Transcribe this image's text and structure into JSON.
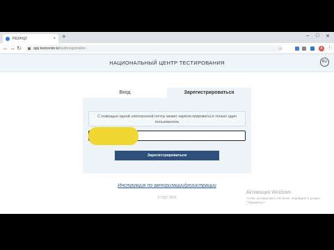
{
  "browser": {
    "tab_title": "РЕЗ/НЦТ",
    "tab_close": "×",
    "new_tab": "+",
    "url_domain": "app.testcenter.kz",
    "url_path": "/auth/registration",
    "profile_initial": "А"
  },
  "header": {
    "title": "НАЦИОНАЛЬНЫЙ ЦЕНТР ТЕСТИРОВАНИЯ",
    "lang": "RU"
  },
  "auth": {
    "tab_login": "Вход",
    "tab_register": "Зарегистрироваться",
    "notice": "С помощью одной электронной почты может зарегистрироваться только один пользователь",
    "email_value": "",
    "submit_label": "Зарегистрироваться"
  },
  "footer": {
    "instruction_link": "Инструкция по авторизации/регистрации",
    "copyright": "© НЦТ 2021"
  },
  "watermark": {
    "line1": "Активация Windows",
    "line2": "Чтобы активировать Windows, перейдите в раздел \"Параметры\"."
  }
}
